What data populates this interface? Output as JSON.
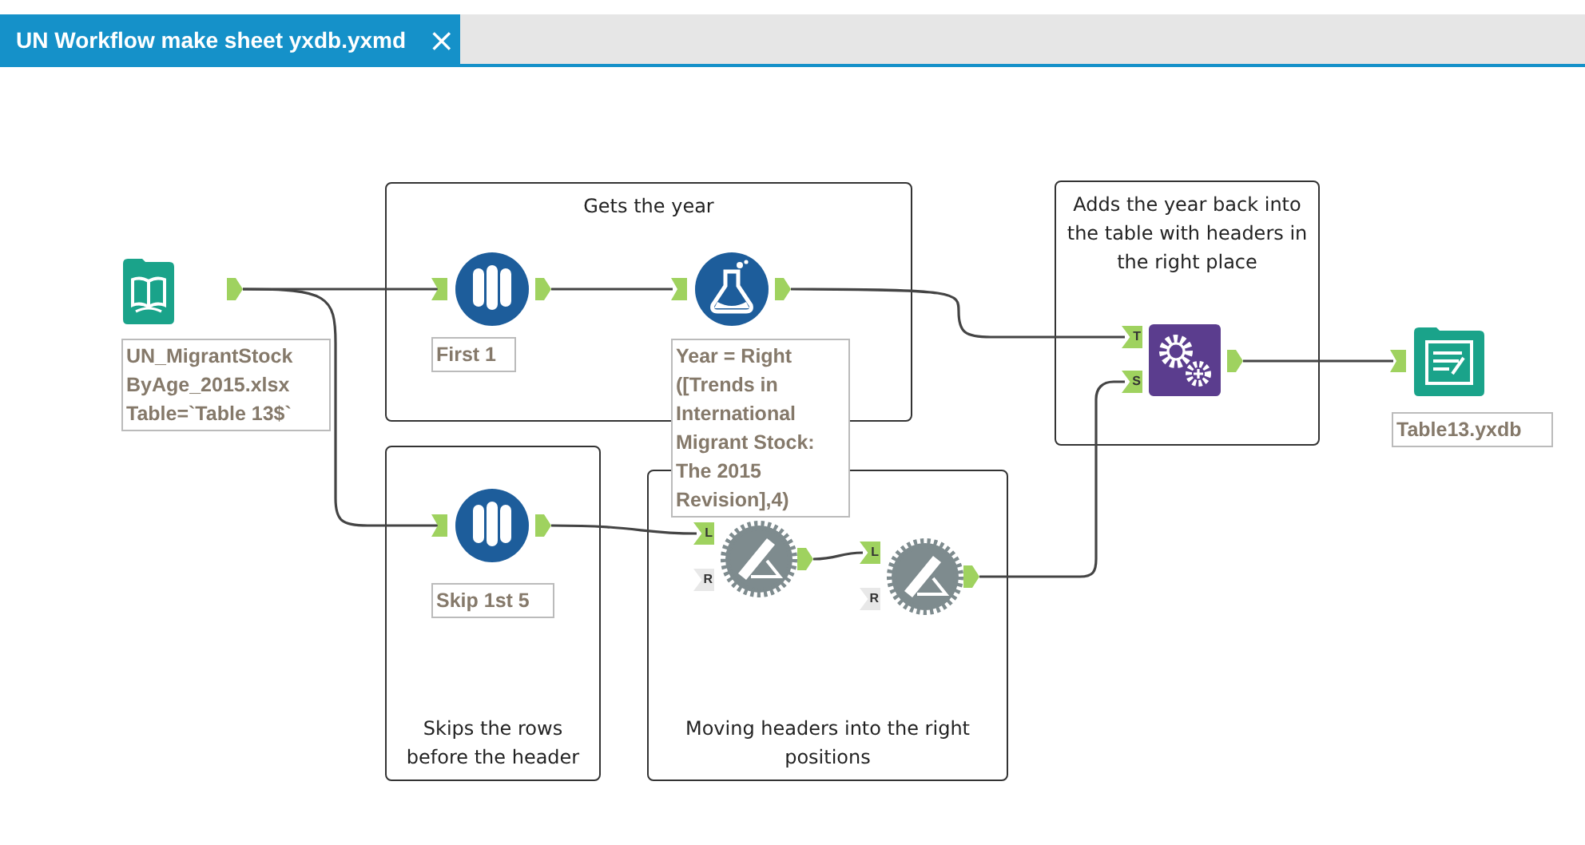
{
  "tab": {
    "title": "UN Workflow make sheet yxdb.yxmd",
    "close": "×",
    "selected": true
  },
  "containers": [
    {
      "caption": "Gets the year",
      "caption_bottom": false
    },
    {
      "caption": "Skips the rows before the header",
      "caption_bottom": true
    },
    {
      "caption": "Moving headers into the right positions",
      "caption_bottom": true
    },
    {
      "caption": "Adds the year back into the table with headers in the right place",
      "caption_bottom": false
    }
  ],
  "tools": [
    {
      "kind": "input",
      "annotation_lines": [
        "UN_MigrantStock",
        "ByAge_2015.xlsx",
        "Table=`Table 13$`"
      ],
      "anchors": [
        {
          "kind": "out",
          "connected": true
        }
      ]
    },
    {
      "kind": "sample",
      "annotation_lines": [
        "First 1"
      ],
      "anchors": [
        {
          "kind": "in",
          "connected": true
        },
        {
          "kind": "out",
          "connected": true
        }
      ]
    },
    {
      "kind": "formula",
      "annotation_lines": [
        "Year = Right",
        "([Trends in",
        "International",
        "Migrant Stock:",
        "The 2015",
        "Revision],4)"
      ],
      "anchors": [
        {
          "kind": "in",
          "connected": true
        },
        {
          "kind": "out",
          "connected": true
        }
      ]
    },
    {
      "kind": "sample",
      "annotation_lines": [
        "Skip 1st 5"
      ],
      "anchors": [
        {
          "kind": "in",
          "connected": true
        },
        {
          "kind": "out",
          "connected": true
        }
      ]
    },
    {
      "kind": "rename",
      "anchors": [
        {
          "kind": "in",
          "letter": "L",
          "connected": true
        },
        {
          "kind": "in",
          "letter": "R",
          "connected": false
        },
        {
          "kind": "out",
          "connected": true
        }
      ]
    },
    {
      "kind": "rename",
      "anchors": [
        {
          "kind": "in",
          "letter": "L",
          "connected": true
        },
        {
          "kind": "in",
          "letter": "R",
          "connected": false
        },
        {
          "kind": "out",
          "connected": true
        }
      ]
    },
    {
      "kind": "append",
      "anchors": [
        {
          "kind": "in",
          "letter": "T",
          "connected": true
        },
        {
          "kind": "in",
          "letter": "S",
          "connected": true
        },
        {
          "kind": "out",
          "connected": true
        }
      ]
    },
    {
      "kind": "output",
      "annotation_lines": [
        "Table13.yxdb"
      ],
      "anchors": [
        {
          "kind": "in",
          "connected": true
        }
      ]
    }
  ]
}
